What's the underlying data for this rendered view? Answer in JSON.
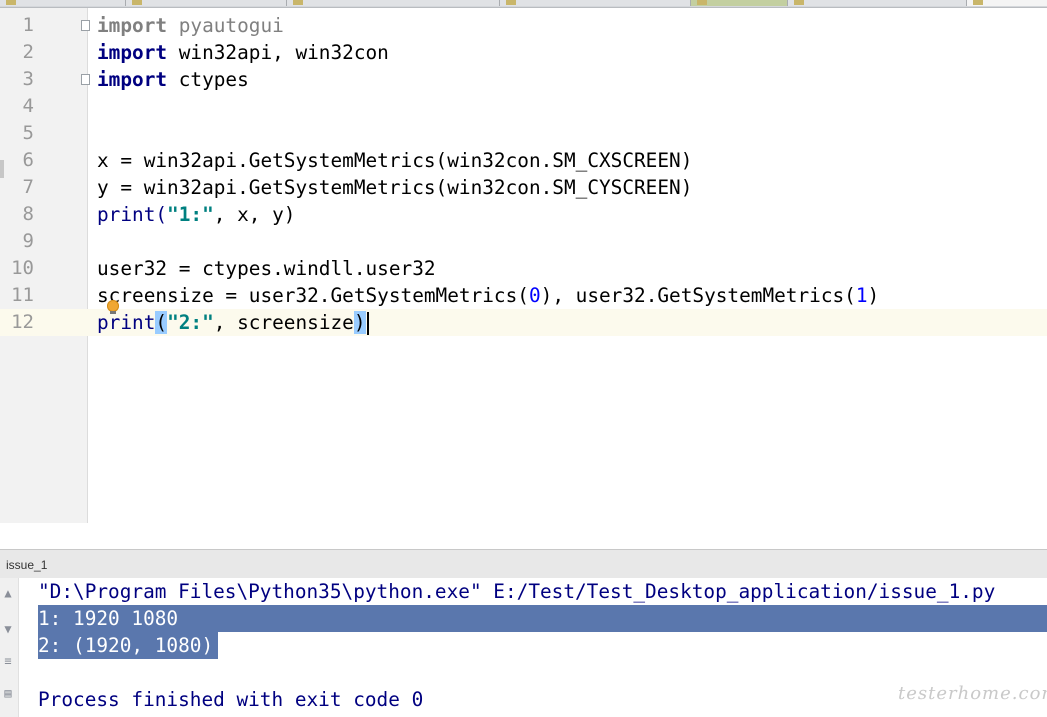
{
  "editor": {
    "lines": [
      {
        "n": "1"
      },
      {
        "n": "2"
      },
      {
        "n": "3"
      },
      {
        "n": "4"
      },
      {
        "n": "5"
      },
      {
        "n": "6"
      },
      {
        "n": "7"
      },
      {
        "n": "8"
      },
      {
        "n": "9"
      },
      {
        "n": "10"
      },
      {
        "n": "11"
      },
      {
        "n": "12"
      }
    ],
    "tokens": {
      "l1_kw": "import",
      "l1_mod": " pyautogui",
      "l2_kw": "import",
      "l2_rest": " win32api, win32con",
      "l3_kw": "import",
      "l3_rest": " ctypes",
      "l6": "x = win32api.GetSystemMetrics(win32con.SM_CXSCREEN)",
      "l7": "y = win32api.GetSystemMetrics(win32con.SM_CYSCREEN)",
      "l8_a": "print(",
      "l8_str": "\"1:\"",
      "l8_b": ", x, y)",
      "l10": "user32 = ctypes.windll.user32",
      "l11_a": "screensize = user32.GetSystemMetrics(",
      "l11_n0": "0",
      "l11_b": "), user32.GetSystemMetrics(",
      "l11_n1": "1",
      "l11_c": ")",
      "l12_a": "print",
      "l12_open": "(",
      "l12_str": "\"2:\"",
      "l12_b": ", screensize",
      "l12_close": ")"
    }
  },
  "run_panel": {
    "title": "issue_1",
    "console": {
      "command": "\"D:\\Program Files\\Python35\\python.exe\" E:/Test/Test_Desktop_application/issue_1.py",
      "out1": "1: 1920 1080",
      "out2": "2: (1920, 1080)",
      "finish": "Process finished with exit code 0"
    }
  },
  "watermark": "testerhome.com",
  "icons": [
    "up-arrow-icon",
    "down-arrow-icon",
    "soft-wrap-icon",
    "print-icon",
    "bulb-icon",
    "fold-icon"
  ],
  "colors": {
    "keyword": "#000080",
    "string": "#008080",
    "number": "#0000ff",
    "selection": "#5a77ad",
    "current_line": "#fcfaed"
  }
}
